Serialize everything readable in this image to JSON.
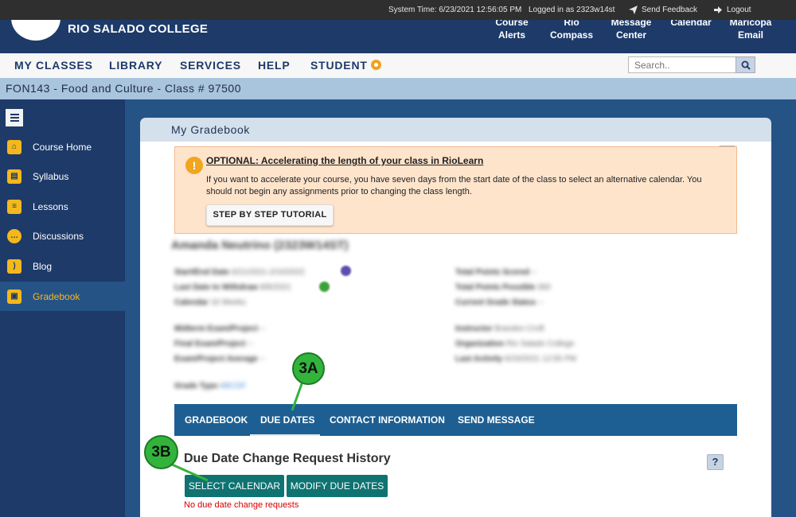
{
  "topbar": {
    "system_time": "System Time: 6/23/2021 12:56:05 PM",
    "logged_in": "Logged in as 2323w14st",
    "send_feedback": "Send Feedback",
    "logout": "Logout"
  },
  "header": {
    "college_name": "RIO SALADO COLLEGE",
    "nav": [
      {
        "label": "Course\nAlerts"
      },
      {
        "label": "Rio\nCompass"
      },
      {
        "label": "Message\nCenter"
      },
      {
        "label": "Calendar"
      },
      {
        "label": "Maricopa\nEmail"
      }
    ]
  },
  "mainnav": {
    "items": [
      "MY CLASSES",
      "LIBRARY",
      "SERVICES",
      "HELP",
      "STUDENT"
    ],
    "search_placeholder": "Search.."
  },
  "course": {
    "title": "FON143 - Food and Culture - Class # 97500"
  },
  "sidebar": {
    "items": [
      {
        "label": "Course Home",
        "icon": "home-icon"
      },
      {
        "label": "Syllabus",
        "icon": "syllabus-icon"
      },
      {
        "label": "Lessons",
        "icon": "lessons-icon"
      },
      {
        "label": "Discussions",
        "icon": "discussions-icon"
      },
      {
        "label": "Blog",
        "icon": "blog-icon"
      },
      {
        "label": "Gradebook",
        "icon": "gradebook-icon",
        "active": true
      }
    ]
  },
  "gradebook": {
    "title": "My Gradebook",
    "help": "?",
    "notice": {
      "title": "OPTIONAL: Accelerating the length of your class in RioLearn",
      "body": "If you want to accelerate your course, you have seven days from the start date of the class to select an alternative calendar. You should not begin any assignments prior to changing the class length.",
      "button": "STEP BY STEP TUTORIAL"
    },
    "student_name": "Amanda Neutrino (2323W14ST)",
    "left_info": [
      {
        "label": "Start/End Date",
        "value": "6/21/2021-2/10/2022"
      },
      {
        "label": "Last Date to Withdraw",
        "value": "8/8/2021"
      },
      {
        "label": "Calendar",
        "value": "16 Weeks"
      },
      {
        "label": "Midterm Exam/Project",
        "value": "--"
      },
      {
        "label": "Final Exam/Project",
        "value": "--"
      },
      {
        "label": "Exam/Project Average",
        "value": "--"
      },
      {
        "label": "Grade Type",
        "value": "ABCDF"
      }
    ],
    "right_info": [
      {
        "label": "Total Points Scored",
        "value": "--"
      },
      {
        "label": "Total Points Possible",
        "value": "360"
      },
      {
        "label": "Current Grade Status",
        "value": "--"
      },
      {
        "label": "Instructor",
        "value": "Brandon Croft"
      },
      {
        "label": "Organization",
        "value": "Rio Salado College"
      },
      {
        "label": "Last Activity",
        "value": "6/23/2021 12:55 PM"
      }
    ],
    "tabs": [
      "GRADEBOOK",
      "DUE DATES",
      "CONTACT INFORMATION",
      "SEND MESSAGE"
    ],
    "section_title": "Due Date Change Request History",
    "buttons": {
      "select_calendar": "SELECT CALENDAR",
      "modify_due_dates": "MODIFY DUE DATES"
    },
    "no_requests": "No due date change requests"
  },
  "callouts": {
    "a": "3A",
    "b": "3B"
  },
  "colors": {
    "navy": "#1d3a69",
    "content_blue": "#255386",
    "tab_blue": "#1d5f92",
    "teal_button": "#0f7372",
    "accent_yellow": "#f4b81d",
    "callout_green": "#32b43c",
    "error_red": "#d60000"
  }
}
